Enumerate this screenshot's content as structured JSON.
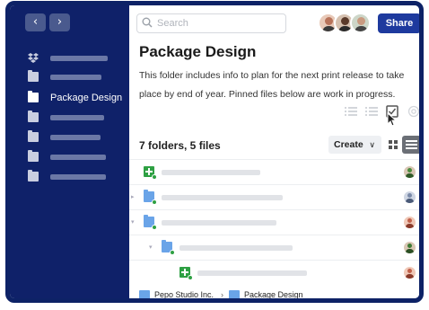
{
  "sidebar": {
    "items": [
      {
        "icon": "dropbox-icon",
        "label": ""
      },
      {
        "icon": "folder-icon",
        "label": ""
      },
      {
        "icon": "folder-icon",
        "label": "Package Design",
        "active": true
      },
      {
        "icon": "folder-icon",
        "label": ""
      },
      {
        "icon": "folder-icon",
        "label": ""
      },
      {
        "icon": "folder-icon",
        "label": ""
      },
      {
        "icon": "folder-icon",
        "label": ""
      }
    ]
  },
  "header": {
    "search_placeholder": "Search",
    "share_label": "Share"
  },
  "folder": {
    "title": "Package Design",
    "description": "This folder includes info to plan for the next print release to take place by end of year. Pinned files below are work in progress."
  },
  "list": {
    "count": "7 folders, 5 files",
    "create_label": "Create"
  },
  "breadcrumb": {
    "items": [
      "Pepo Studio Inc.",
      "Package Design"
    ],
    "separator": "›"
  },
  "colors": {
    "sidebar": "#0f2169",
    "accent": "#1e3a9e",
    "sheet": "#2ea043",
    "folder": "#6aa4e8"
  }
}
